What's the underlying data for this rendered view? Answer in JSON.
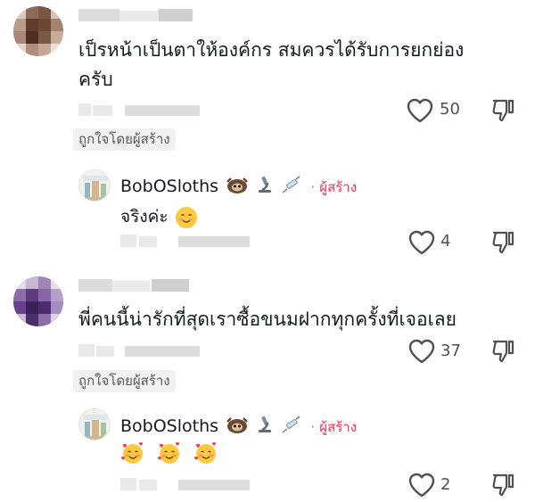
{
  "comments": [
    {
      "text_line1": "เป็รหน้าเป็นตาให้องค์กร สมควรได้รับการยกย่อง",
      "text_line2": "ครับ",
      "likes": "50",
      "liked_by_creator": "ถูกใจโดยผู้สร้าง",
      "reply": {
        "username": "BobOSloths",
        "separator": "·",
        "creator_badge": "ผู้สร้าง",
        "text": "จริงค่ะ",
        "likes": "4"
      }
    },
    {
      "text_line1": "พี่คนนี้น่ารักที่สุดเราซื้อขนมฝากทุกครั้งที่เจอเลย",
      "likes": "37",
      "liked_by_creator": "ถูกใจโดยผู้สร้าง",
      "reply": {
        "username": "BobOSloths",
        "separator": "·",
        "creator_badge": "ผู้สร้าง",
        "likes": "2"
      }
    }
  ],
  "colors": {
    "creator": "#fe2c55",
    "text": "#161823",
    "muted": "#57585e"
  },
  "icons": [
    "heart-outline-icon",
    "dislike-icon",
    "sloth-emoji",
    "microscope-emoji",
    "syringe-emoji",
    "smiling-face-emoji",
    "smiling-face-with-hearts-emoji"
  ]
}
